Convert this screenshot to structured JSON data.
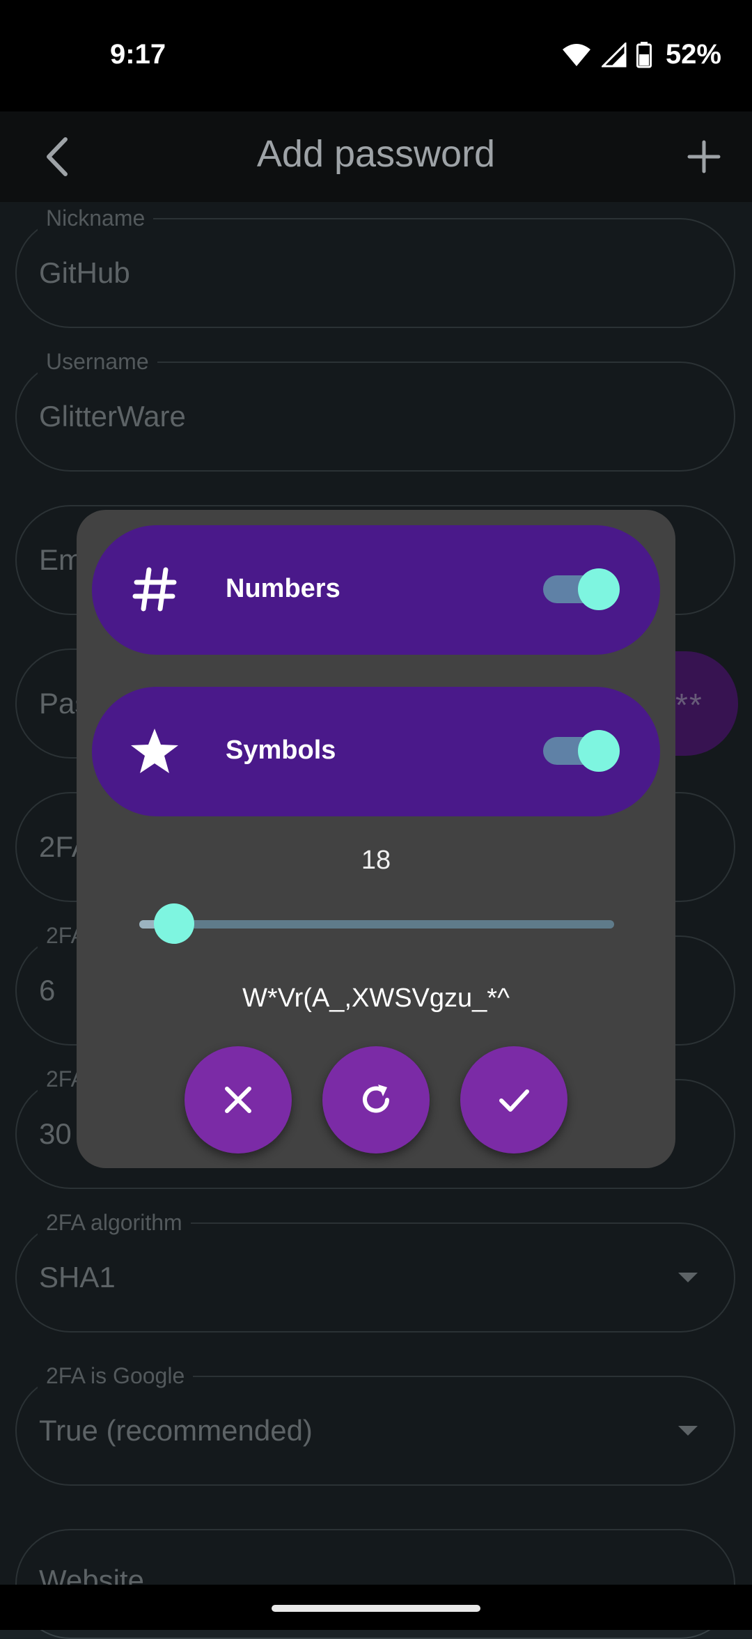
{
  "status": {
    "time": "9:17",
    "battery": "52%"
  },
  "appbar": {
    "title": "Add password"
  },
  "form": {
    "nickname": {
      "label": "Nickname",
      "value": "GitHub"
    },
    "username": {
      "label": "Username",
      "value": "GlitterWare"
    },
    "email": {
      "value": "Em"
    },
    "password": {
      "value": "Pas"
    },
    "twofa_secret": {
      "value": "2FA"
    },
    "twofa_digits": {
      "label": "2FA",
      "value": "6"
    },
    "twofa_period": {
      "label": "2FA",
      "value": "30"
    },
    "twofa_algorithm": {
      "label": "2FA algorithm",
      "value": "SHA1"
    },
    "twofa_google": {
      "label": "2FA is Google",
      "value": "True (recommended)"
    },
    "website": {
      "value": "Website"
    },
    "password_bubble": "**"
  },
  "dialog": {
    "numbers": {
      "label": "Numbers",
      "enabled": true,
      "icon": "hash-icon"
    },
    "symbols": {
      "label": "Symbols",
      "enabled": true,
      "icon": "star-icon"
    },
    "length": "18",
    "slider_fraction": 0.05,
    "generated_password": "W*Vr(A_,XWSVgzu_*^",
    "buttons": [
      "close-icon",
      "refresh-icon",
      "check-icon"
    ]
  },
  "colors": {
    "accent_purple": "#4a198a",
    "fab_purple": "#7b2ba6",
    "toggle_thumb": "#7ef5e0",
    "dialog_bg": "#424242"
  }
}
